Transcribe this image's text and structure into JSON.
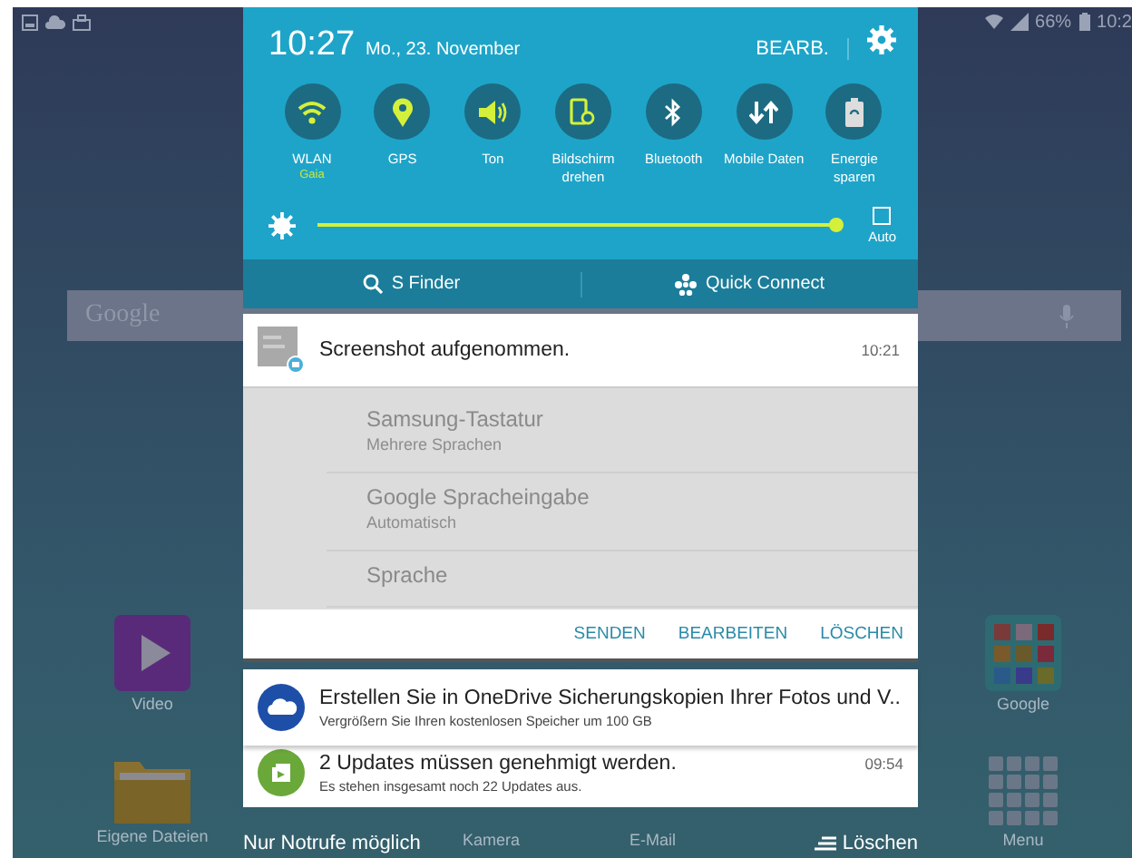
{
  "status_bar": {
    "battery": "66%",
    "time": "10:2"
  },
  "home_screen": {
    "search": {
      "placeholder": "Google"
    },
    "apps": [
      {
        "name": "Video",
        "kind": "video"
      },
      {
        "name": "Google",
        "kind": "group"
      },
      {
        "name": "Eigene Dateien",
        "kind": "folder"
      },
      {
        "name": "Menu",
        "kind": "menu"
      }
    ],
    "dock_labels": [
      "Kamera",
      "E-Mail"
    ]
  },
  "quick_panel": {
    "time": "10:27",
    "date": "Mo., 23. November",
    "edit": "BEARB.",
    "toggles": [
      {
        "label": "WLAN",
        "sublabel": "Gaia",
        "kind": "wifi",
        "on": true
      },
      {
        "label": "GPS",
        "kind": "gps",
        "on": true
      },
      {
        "label": "Ton",
        "kind": "sound",
        "on": true
      },
      {
        "label": "Bildschirm drehen",
        "kind": "rotate",
        "on": true
      },
      {
        "label": "Bluetooth",
        "kind": "bluetooth",
        "on": false
      },
      {
        "label": "Mobile Daten",
        "kind": "data",
        "on": false
      },
      {
        "label": "Energie sparen",
        "kind": "power",
        "on": false
      }
    ],
    "brightness": {
      "level": 0.98,
      "auto_label": "Auto",
      "auto": false
    },
    "shortcuts": [
      "S Finder",
      "Quick Connect"
    ]
  },
  "notifications": [
    {
      "kind": "screenshot",
      "title": "Screenshot aufgenommen.",
      "time": "10:21",
      "preview": [
        {
          "title": "Samsung-Tastatur",
          "subtitle": "Mehrere Sprachen"
        },
        {
          "title": "Google Spracheingabe",
          "subtitle": "Automatisch"
        },
        {
          "title": "Sprache"
        }
      ],
      "actions": [
        "SENDEN",
        "BEARBEITEN",
        "LÖSCHEN"
      ]
    },
    {
      "kind": "onedrive",
      "title": "Erstellen Sie in OneDrive Sicherungskopien Ihrer Fotos und V..",
      "subtitle": "Vergrößern Sie Ihren kostenlosen Speicher um 100 GB"
    },
    {
      "kind": "updates",
      "title": "2 Updates müssen genehmigt werden.",
      "time": "09:54",
      "subtitle": "Es stehen insgesamt noch 22 Updates aus."
    }
  ],
  "footer": {
    "emergency": "Nur Notrufe möglich",
    "clear": "Löschen"
  }
}
